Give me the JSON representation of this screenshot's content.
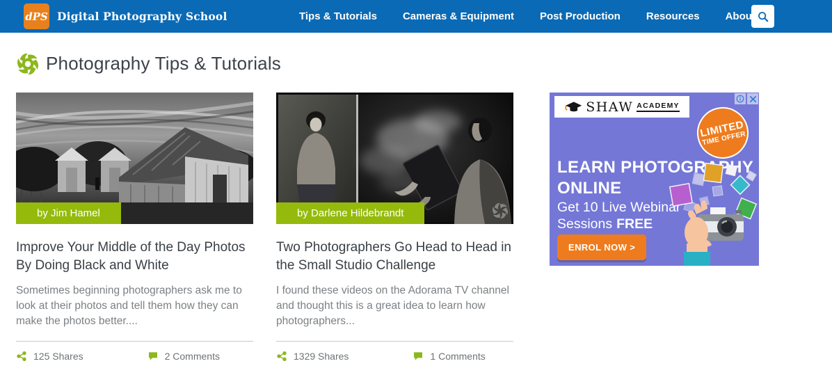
{
  "header": {
    "logo_glyph": "dPS",
    "site_name": "Digital Photography School",
    "nav": [
      "Tips & Tutorials",
      "Cameras & Equipment",
      "Post Production",
      "Resources",
      "About Us"
    ]
  },
  "page_title": "Photography Tips & Tutorials",
  "articles": [
    {
      "author": "by Jim Hamel",
      "title": "Improve Your Middle of the Day Photos By Doing Black and White",
      "excerpt": "Sometimes beginning photographers ask me to look at their photos and tell them how they can make the photos better....",
      "shares": "125 Shares",
      "comments": "2 Comments",
      "image_desc": "black and white photo of an old barn and grain silos under a dramatic sky"
    },
    {
      "author": "by Darlene Hildebrandt",
      "title": "Two Photographers Go Head to Head in the Small Studio Challenge",
      "excerpt": "I found these videos on the Adorama TV channel and thought this is a great idea to learn how photographers...",
      "shares": "1329 Shares",
      "comments": "1 Comments",
      "image_desc": "black and white diptych of two portrait photographs from a small studio shoot"
    }
  ],
  "ad": {
    "brand": "SHAW",
    "brand_suffix": "ACADEMY",
    "badge_line1": "LIMITED",
    "badge_line2": "TIME OFFER",
    "headline_line1": "LEARN PHOTOGRAPHY",
    "headline_line2": "ONLINE",
    "sub_line1": "Get 10 Live Webinar",
    "sub_line2_prefix": "Sessions",
    "sub_line2_bold": "FREE",
    "cta": "ENROL NOW >"
  },
  "colors": {
    "header_blue": "#0a6ab5",
    "logo_orange": "#e8811d",
    "accent_green": "#96ba0c",
    "ad_purple": "#7477d6",
    "ad_orange": "#ee7c1e"
  }
}
